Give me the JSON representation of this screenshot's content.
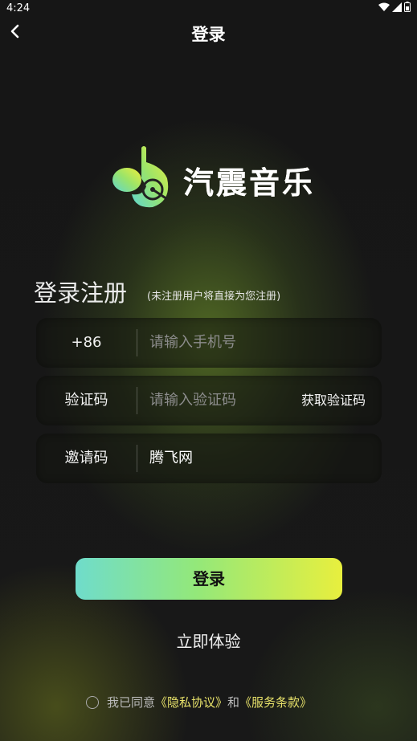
{
  "status_bar": {
    "time": "4:24"
  },
  "header": {
    "title": "登录"
  },
  "brand": {
    "name": "汽震音乐"
  },
  "form": {
    "heading": "登录注册",
    "subheading": "(未注册用户将直接为您注册)",
    "phone": {
      "label": "+86",
      "placeholder": "请输入手机号",
      "value": ""
    },
    "code": {
      "label": "验证码",
      "placeholder": "请输入验证码",
      "value": "",
      "action": "获取验证码"
    },
    "invite": {
      "label": "邀请码",
      "value": "腾飞网"
    }
  },
  "actions": {
    "login": "登录",
    "try_now": "立即体验"
  },
  "agreement": {
    "prefix": "我已同意",
    "privacy": "《隐私协议》",
    "and": "和",
    "terms": "《服务条款》"
  },
  "colors": {
    "accent_start": "#6fdccb",
    "accent_end": "#e8ef3e",
    "link": "#e8e26a"
  }
}
